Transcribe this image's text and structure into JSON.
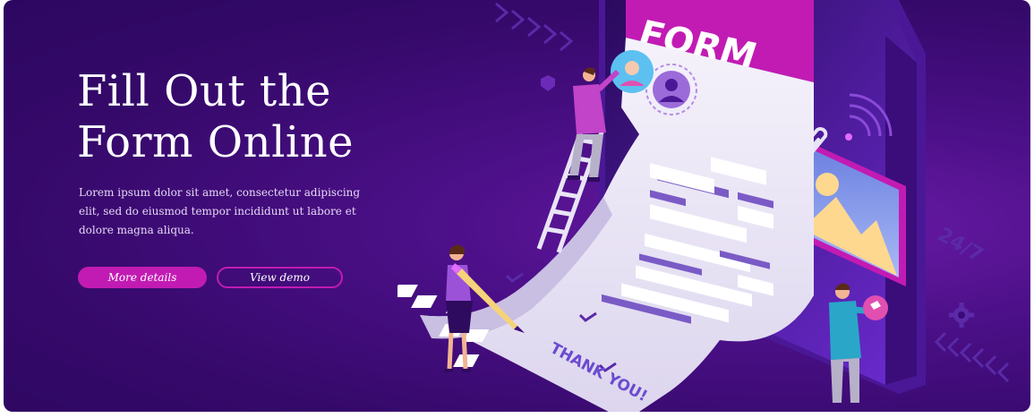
{
  "hero": {
    "title_line1": "Fill Out the",
    "title_line2": "Form Online",
    "description": "Lorem ipsum dolor sit amet, consectetur adipiscing elit, sed do eiusmod tempor incididunt ut labore et dolore magna aliqua.",
    "primary_button": "More details",
    "secondary_button": "View demo"
  },
  "illustration": {
    "form_heading": "FORM",
    "receipt_footer": "THANK YOU!",
    "clock_badge": "24/7",
    "icons": [
      "user-avatar-icon",
      "paperclip-icon",
      "image-icon",
      "gear-icon",
      "wifi-signal-icon",
      "checkmark-icon",
      "pencil-icon",
      "ladder-icon"
    ]
  },
  "colors": {
    "background": "#3b0a78",
    "accent": "#c21bb3",
    "text": "#ffffff",
    "form_header": "#c21bb3",
    "paper": "#ece8f6"
  }
}
